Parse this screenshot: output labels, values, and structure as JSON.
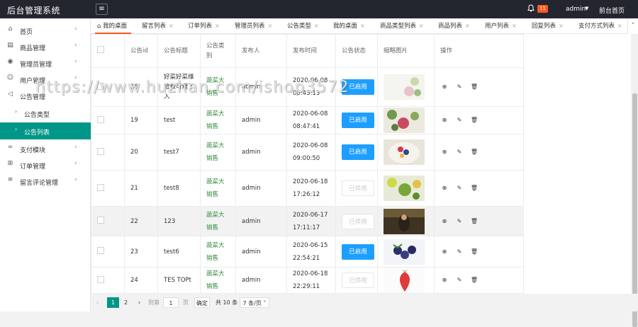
{
  "header": {
    "app_title": "后台管理系统",
    "menu_icon": "≡",
    "notify_count": "11",
    "user": "admin",
    "front_link": "前台首页"
  },
  "sidebar": {
    "items": [
      {
        "icon": "home-icon",
        "label": "首页"
      },
      {
        "icon": "goods-icon",
        "label": "商品管理"
      },
      {
        "icon": "admin-user-icon",
        "label": "管理员管理"
      },
      {
        "icon": "user-icon",
        "label": "用户管理"
      },
      {
        "icon": "speaker-icon",
        "label": "公告管理"
      }
    ],
    "subitems": [
      {
        "label": "公告类型"
      },
      {
        "label": "公告列表"
      }
    ],
    "items2": [
      {
        "icon": "link-icon",
        "label": "支付模块"
      },
      {
        "icon": "sitemap-icon",
        "label": "订单管理"
      },
      {
        "icon": "database-icon",
        "label": "留言评论管理"
      }
    ]
  },
  "tabs": [
    "我的桌面",
    "留言列表",
    "订单列表",
    "管理员列表",
    "公告类型",
    "我的桌面",
    "商品类型列表",
    "商品列表",
    "用户列表",
    "回复列表",
    "支付方式列表"
  ],
  "table": {
    "headers": [
      "公告id",
      "公告标题",
      "公告类别",
      "发布人",
      "发布时间",
      "公告状态",
      "缩略图片",
      "操作"
    ],
    "rows": [
      {
        "id": "16",
        "title": "好菜好菜维拾费可理了入",
        "cat": "蔬菜大销售",
        "pub": "admin",
        "time": "2020-06-08 00:45:13",
        "status": "已启用",
        "on": true
      },
      {
        "id": "19",
        "title": "test",
        "cat": "蔬菜大销售",
        "pub": "admin",
        "time": "2020-06-08 08:47:41",
        "status": "已启用",
        "on": true
      },
      {
        "id": "20",
        "title": "test7",
        "cat": "蔬菜大销售",
        "pub": "admin",
        "time": "2020-06-08 09:00:50",
        "status": "已启用",
        "on": true
      },
      {
        "id": "21",
        "title": "test8",
        "cat": "蔬菜大销售",
        "pub": "admin",
        "time": "2020-06-18 17:26:12",
        "status": "已停用",
        "on": false
      },
      {
        "id": "22",
        "title": "123",
        "cat": "蔬菜大销售",
        "pub": "admin",
        "time": "2020-06-17 17:11:17",
        "status": "已停用",
        "on": false
      },
      {
        "id": "23",
        "title": "test6",
        "cat": "蔬菜大销售",
        "pub": "admin",
        "time": "2020-06-15 22:54:21",
        "status": "已启用",
        "on": true
      },
      {
        "id": "24",
        "title": "TES TOPt",
        "cat": "蔬菜大销售",
        "pub": "admin",
        "time": "2020-06-18 22:29:11",
        "status": "已停用",
        "on": false
      }
    ]
  },
  "pager": {
    "prev": "‹",
    "cur": "1",
    "p2": "2",
    "next": "›",
    "goto": "到第",
    "page_input": "1",
    "page_unit": "页",
    "confirm": "确定",
    "total": "共 10 条",
    "size": "7 条/页"
  },
  "watermark": "https://www.huzhan.com/ishop3572"
}
